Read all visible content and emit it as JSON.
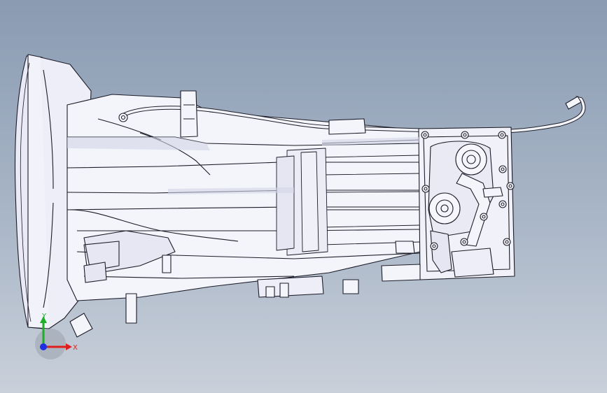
{
  "viewport": {
    "background_top": "#8a9bb2",
    "background_bottom": "#c9d0da",
    "model_fill": "#f4f4fb",
    "model_edge": "#1c1c28",
    "model_shade": "#d2d3e6"
  },
  "triad": {
    "x_label": "X",
    "y_label": "Y",
    "x_color": "#e02020",
    "y_color": "#1fae2a",
    "z_color": "#2030e0"
  }
}
